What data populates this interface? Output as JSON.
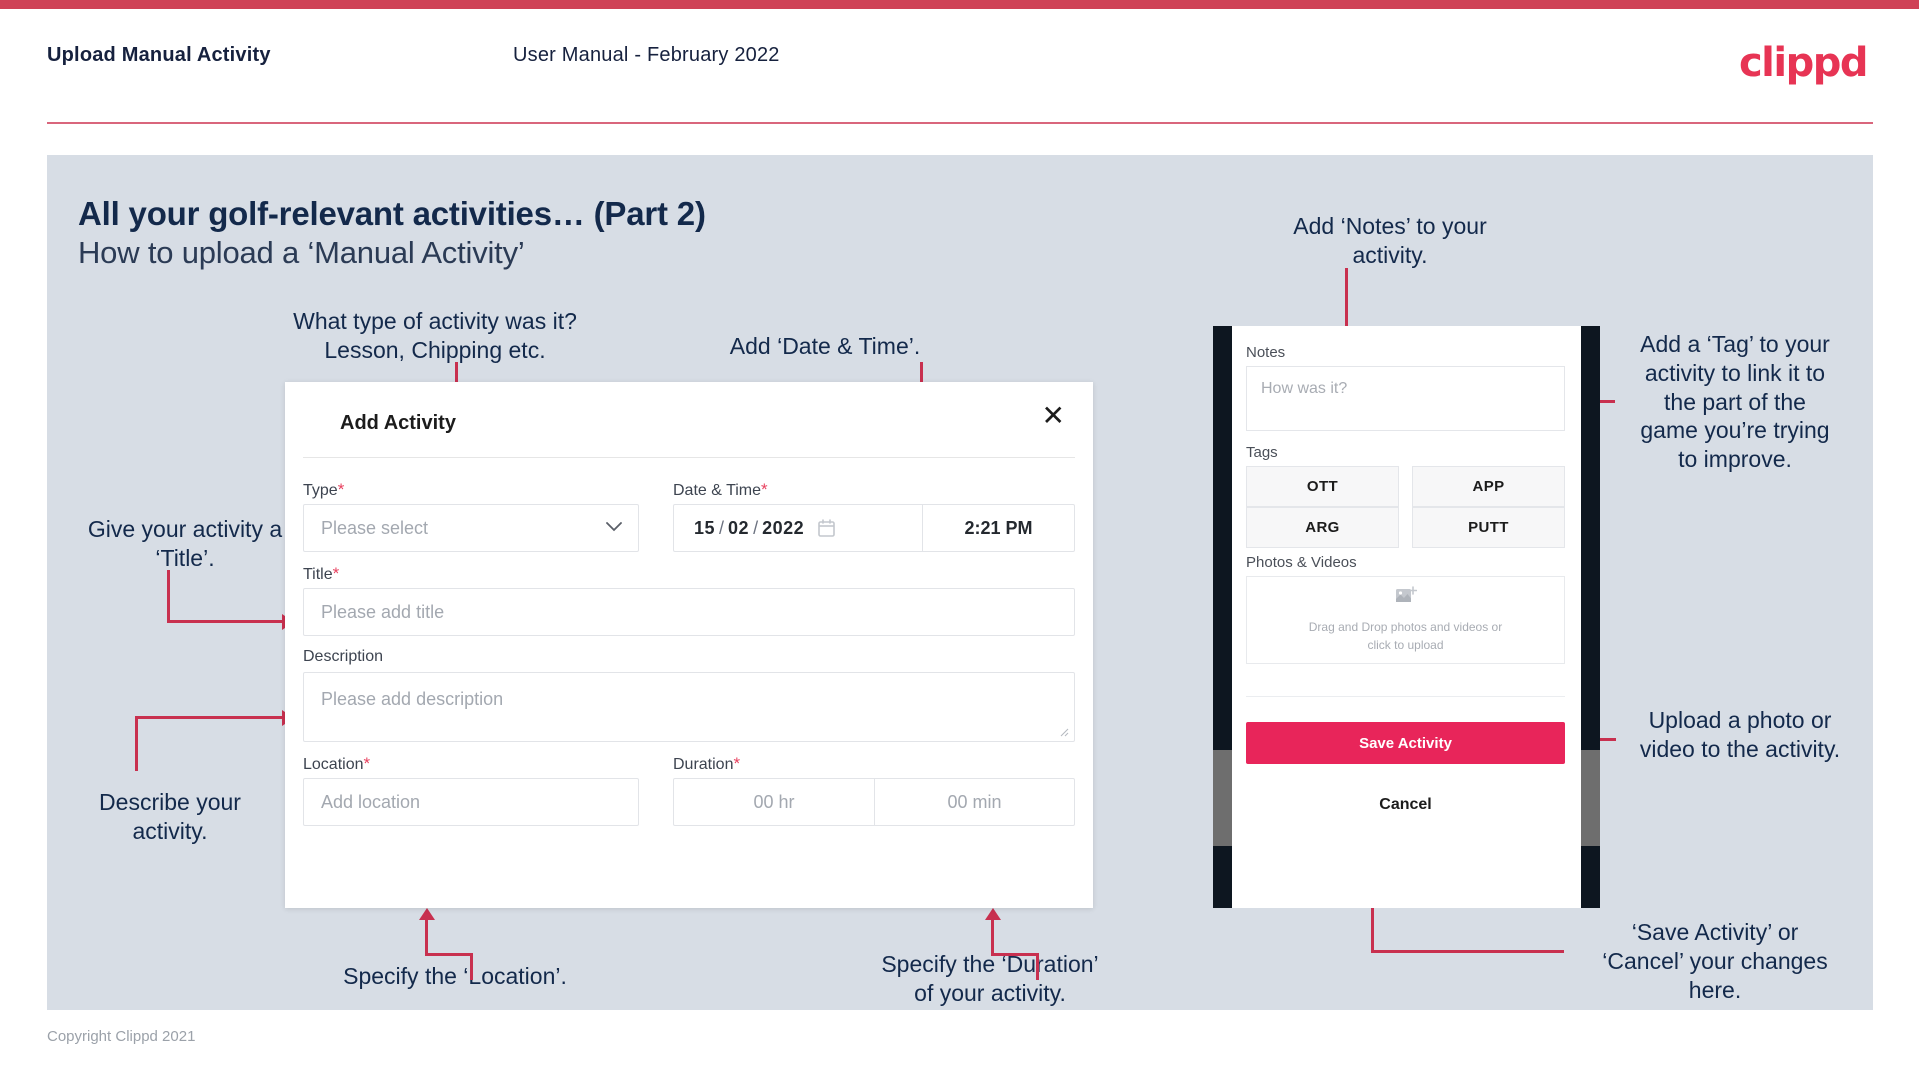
{
  "meta": {
    "accent": "#e8255a",
    "crimson": "#c8304f",
    "slide_bg": "#d7dde5",
    "navy": "#13294b"
  },
  "header": {
    "title": "Upload Manual Activity",
    "subtitle": "User Manual - February 2022",
    "logo": "clippd"
  },
  "slide": {
    "heading": "All your golf-relevant activities… (Part 2)",
    "subheading": "How to upload a ‘Manual Activity’"
  },
  "annotations": {
    "type": "What type of activity was it?\nLesson, Chipping etc.",
    "type_l1": "What type of activity was it?",
    "type_l2": "Lesson, Chipping etc.",
    "datetime": "Add ‘Date & Time’.",
    "title": "Give your activity a\n‘Title’.",
    "title_l1": "Give your activity a",
    "title_l2": "‘Title’.",
    "description_l1": "Describe your",
    "description_l2": "activity.",
    "location": "Specify the ‘Location’.",
    "duration_l1": "Specify the ‘Duration’",
    "duration_l2": "of your activity.",
    "notes_l1": "Add ‘Notes’ to your",
    "notes_l2": "activity.",
    "tag_l1": "Add a ‘Tag’ to your",
    "tag_l2": "activity to link it to",
    "tag_l3": "the part of the",
    "tag_l4": "game you’re trying",
    "tag_l5": "to improve.",
    "upload_l1": "Upload a photo or",
    "upload_l2": "video to the activity.",
    "save_l1": "‘Save Activity’ or",
    "save_l2": "‘Cancel’ your changes",
    "save_l3": "here."
  },
  "dialog": {
    "title": "Add Activity",
    "close_icon": "close-icon",
    "fields": {
      "type": {
        "label": "Type",
        "required": "*",
        "placeholder": "Please select",
        "chevron": "chevron-down-icon"
      },
      "datetime": {
        "label": "Date & Time",
        "required": "*",
        "day": "15",
        "month": "02",
        "year": "2022",
        "sep": "/",
        "time": "2:21 PM",
        "calendar_icon": "calendar-icon"
      },
      "title": {
        "label": "Title",
        "required": "*",
        "placeholder": "Please add title"
      },
      "description": {
        "label": "Description",
        "required": "",
        "placeholder": "Please add description"
      },
      "location": {
        "label": "Location",
        "required": "*",
        "placeholder": "Add location"
      },
      "duration": {
        "label": "Duration",
        "required": "*",
        "hours": "00 hr",
        "minutes": "00 min"
      }
    }
  },
  "phone": {
    "notes": {
      "label": "Notes",
      "placeholder": "How was it?"
    },
    "tags": {
      "label": "Tags",
      "items": [
        {
          "label": "OTT"
        },
        {
          "label": "APP"
        },
        {
          "label": "ARG"
        },
        {
          "label": "PUTT"
        }
      ]
    },
    "photos": {
      "label": "Photos & Videos",
      "icon": "add-image-icon",
      "line1": "Drag and Drop photos and videos or",
      "line2": "click to upload"
    },
    "save_label": "Save Activity",
    "cancel_label": "Cancel"
  },
  "footer": {
    "copyright": "Copyright Clippd 2021"
  }
}
